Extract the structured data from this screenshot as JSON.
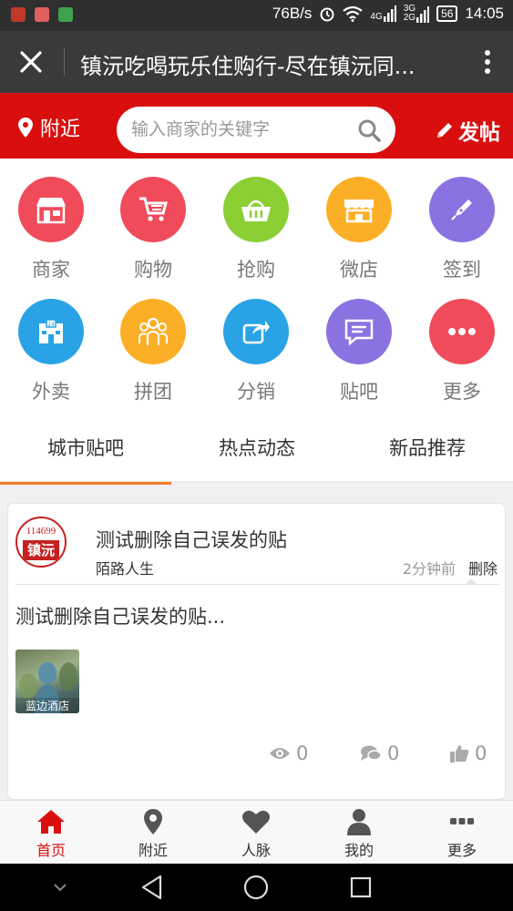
{
  "status_bar": {
    "net_speed": "76B/s",
    "net_type_1": "4G",
    "net_type_2a": "3G",
    "net_type_2b": "2G",
    "battery": "56",
    "time": "14:05"
  },
  "titlebar": {
    "title": "镇沅吃喝玩乐住购行-尽在镇沅同..."
  },
  "header": {
    "location_label": "附近",
    "search_placeholder": "输入商家的关键字",
    "post_label": "发帖"
  },
  "grid": {
    "items": [
      {
        "label": "商家",
        "icon": "storefront-icon",
        "color": "#ef4b5a"
      },
      {
        "label": "购物",
        "icon": "shopping-cart-icon",
        "color": "#ef4b5a"
      },
      {
        "label": "抢购",
        "icon": "basket-icon",
        "color": "#8ccf34"
      },
      {
        "label": "微店",
        "icon": "shop-awning-icon",
        "color": "#fbaf27"
      },
      {
        "label": "签到",
        "icon": "pen-nib-icon",
        "color": "#8a73e0"
      },
      {
        "label": "外卖",
        "icon": "24h-store-icon",
        "color": "#2aa3e6"
      },
      {
        "label": "拼团",
        "icon": "group-icon",
        "color": "#fbaf27"
      },
      {
        "label": "分销",
        "icon": "share-icon",
        "color": "#2aa3e6"
      },
      {
        "label": "贴吧",
        "icon": "message-icon",
        "color": "#8a73e0"
      },
      {
        "label": "更多",
        "icon": "more-dots-icon",
        "color": "#ef4b5a"
      }
    ]
  },
  "tabs": [
    {
      "label": "城市贴吧",
      "active": true
    },
    {
      "label": "热点动态",
      "active": false
    },
    {
      "label": "新品推荐",
      "active": false
    }
  ],
  "post": {
    "avatar_number": "114699",
    "avatar_name": "镇沅",
    "title": "测试删除自己误发的贴",
    "author": "陌路人生",
    "time": "2分钟前",
    "delete_label": "删除",
    "body": "测试删除自己误发的贴...",
    "thumb_caption": "蓝边酒店",
    "views": "0",
    "comments": "0",
    "likes": "0"
  },
  "bottom_nav": [
    {
      "label": "首页",
      "icon": "home-icon",
      "active": true
    },
    {
      "label": "附近",
      "icon": "location-pin-icon",
      "active": false
    },
    {
      "label": "人脉",
      "icon": "heart-icon",
      "active": false
    },
    {
      "label": "我的",
      "icon": "user-icon",
      "active": false
    },
    {
      "label": "更多",
      "icon": "more-icon",
      "active": false
    }
  ],
  "colors": {
    "brand_red": "#d90f0f",
    "tab_accent": "#f07a28",
    "titlebar": "#3a3a3a"
  }
}
